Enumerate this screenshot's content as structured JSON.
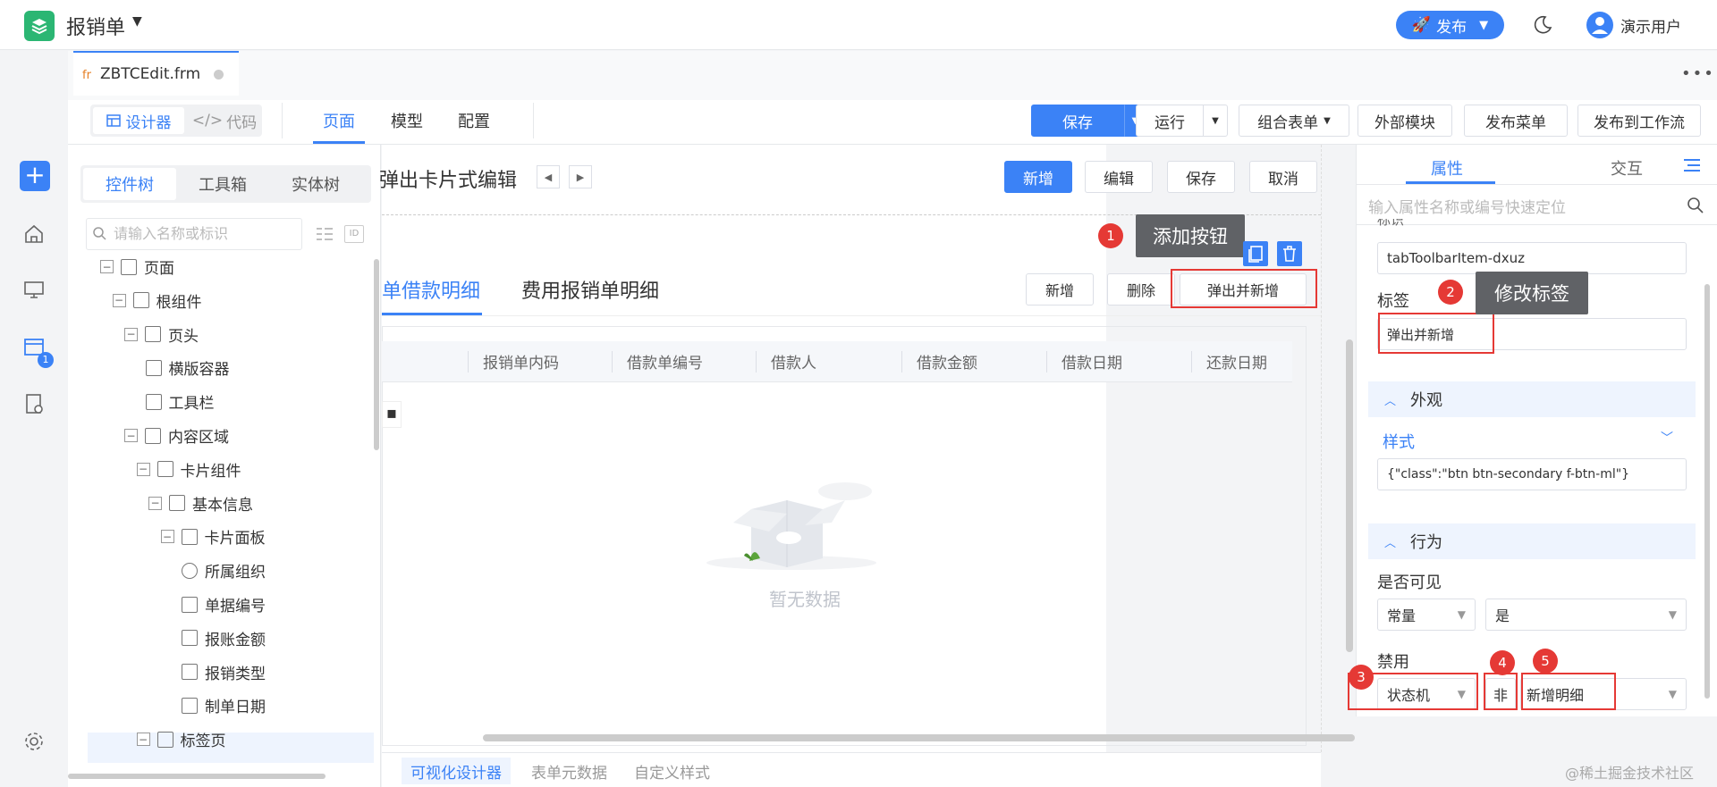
{
  "app": {
    "title": "报销单",
    "publish": "发布",
    "user": "演示用户"
  },
  "file_tab": {
    "icon_text": "fr",
    "label": "ZBTCEdit.frm"
  },
  "view_switch": {
    "designer": "设计器",
    "code": "代码"
  },
  "page_tabs": [
    "页面",
    "模型",
    "配置"
  ],
  "toolbar": {
    "save": "保存",
    "run": "运行",
    "combine_form": "组合表单",
    "external_module": "外部模块",
    "publish_menu": "发布菜单",
    "publish_workflow": "发布到工作流"
  },
  "left_panel": {
    "tabs": [
      "控件树",
      "工具箱",
      "实体树"
    ],
    "search_placeholder": "请输入名称或标识",
    "tree": [
      {
        "label": "页面",
        "level": 0,
        "toggle": "−",
        "icon": "page-icon"
      },
      {
        "label": "根组件",
        "level": 1,
        "toggle": "−",
        "icon": "component-icon"
      },
      {
        "label": "页头",
        "level": 2,
        "toggle": "−",
        "icon": "region-icon"
      },
      {
        "label": "横版容器",
        "level": 3,
        "toggle": "",
        "icon": "container-icon"
      },
      {
        "label": "工具栏",
        "level": 3,
        "toggle": "",
        "icon": "button-icon"
      },
      {
        "label": "内容区域",
        "level": 2,
        "toggle": "−",
        "icon": "region-icon"
      },
      {
        "label": "卡片组件",
        "level": 3,
        "toggle": "−",
        "icon": "component-icon"
      },
      {
        "label": "基本信息",
        "level": 4,
        "toggle": "−",
        "icon": "section-icon"
      },
      {
        "label": "卡片面板",
        "level": 5,
        "toggle": "−",
        "icon": "panel-icon"
      },
      {
        "label": "所属组织",
        "level": 6,
        "toggle": "",
        "icon": "help-icon"
      },
      {
        "label": "单据编号",
        "level": 6,
        "toggle": "",
        "icon": "textbox-icon"
      },
      {
        "label": "报账金额",
        "level": 6,
        "toggle": "",
        "icon": "number-icon"
      },
      {
        "label": "报销类型",
        "level": 6,
        "toggle": "",
        "icon": "dropdown-icon"
      },
      {
        "label": "制单日期",
        "level": 6,
        "toggle": "",
        "icon": "calendar-icon"
      },
      {
        "label": "标签页",
        "level": 3,
        "toggle": "−",
        "icon": "tabs-icon"
      }
    ]
  },
  "canvas": {
    "title": "弹出卡片式编辑",
    "header_buttons": [
      "新增",
      "编辑",
      "保存",
      "取消"
    ],
    "annotation1": {
      "num": "1",
      "text": "添加按钮"
    },
    "tabs": [
      "单借款明细",
      "费用报销单明细"
    ],
    "section_buttons": [
      "新增",
      "删除",
      "弹出并新增"
    ],
    "grid_headers": [
      "报销单内码",
      "借款单编号",
      "借款人",
      "借款金额",
      "借款日期",
      "还款日期"
    ],
    "empty_text": "暂无数据",
    "grid_bit": "▪"
  },
  "bottom_tabs": [
    "可视化设计器",
    "表单元数据",
    "自定义样式"
  ],
  "right_panel": {
    "tabs": [
      "属性",
      "交互"
    ],
    "search_placeholder": "输入属性名称或编号快速定位",
    "clipped_label": "标识",
    "id_value": "tabToolbarItem-dxuz",
    "label_title": "标签",
    "label_value": "弹出并新增",
    "annotation2": {
      "num": "2",
      "text": "修改标签"
    },
    "section_appearance": "外观",
    "style_label": "样式",
    "style_value": "{\"class\":\"btn btn-secondary f-btn-ml\"}",
    "section_behavior": "行为",
    "visible_label": "是否可见",
    "visible_mode": "常量",
    "visible_value": "是",
    "disabled_label": "禁用",
    "disabled_mode": "状态机",
    "disabled_not": "非",
    "disabled_value": "新增明细",
    "ann3": "3",
    "ann4": "4",
    "ann5": "5"
  },
  "rail_badge": "1",
  "watermark": "@稀土掘金技术社区"
}
